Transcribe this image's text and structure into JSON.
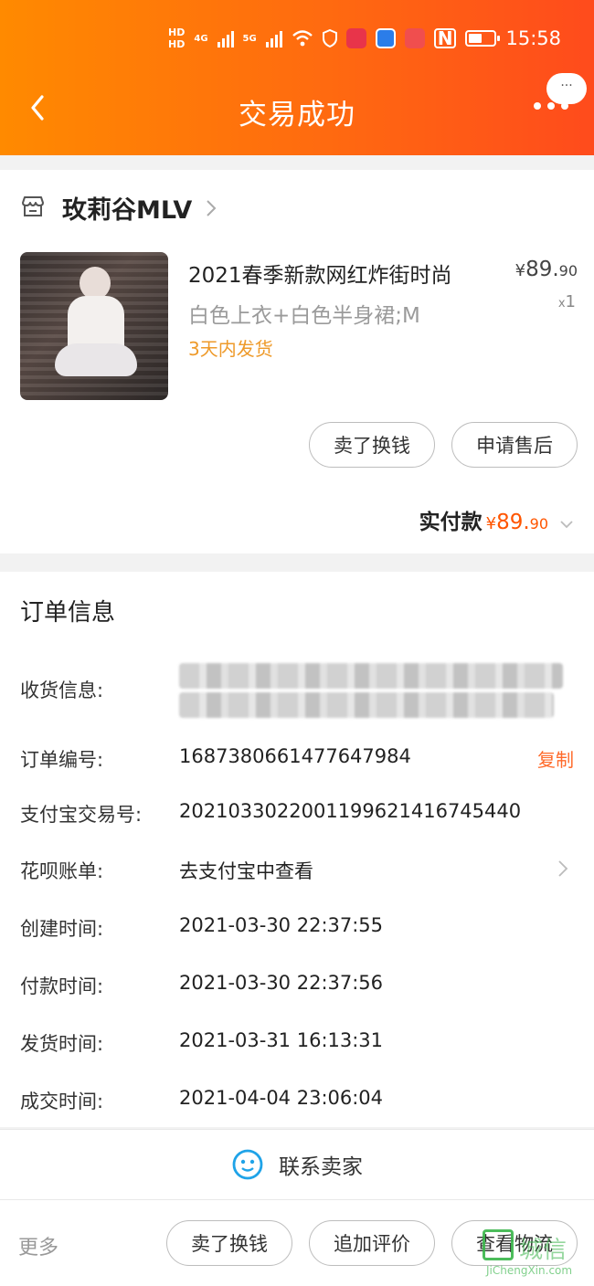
{
  "status_bar": {
    "time": "15:58",
    "hd1": "HD",
    "hd2": "HD",
    "net1": "4G",
    "net2": "5G",
    "icons": [
      "hd-icon",
      "signal-icon",
      "wifi-icon",
      "shield-icon",
      "app-icon-red",
      "app-icon-blue",
      "app-icon-play",
      "nfc-icon",
      "battery-icon"
    ]
  },
  "header": {
    "title": "交易成功",
    "bubble": "···"
  },
  "shop": {
    "name": "玫莉谷MLV"
  },
  "product": {
    "title": "2021春季新款网红炸街时尚",
    "spec": "白色上衣+白色半身裙;M",
    "ship_note": "3天内发货",
    "price_currency": "¥",
    "price_int": "89.",
    "price_dec": "90",
    "qty_prefix": "x",
    "qty": "1"
  },
  "actions": {
    "sell_label": "卖了换钱",
    "after_sale_label": "申请售后"
  },
  "paid": {
    "label": "实付款",
    "currency": "¥",
    "amount_int": "89.",
    "amount_dec": "90"
  },
  "order_info": {
    "title": "订单信息",
    "shipping_label": "收货信息:",
    "order_no_label": "订单编号:",
    "order_no": "1687380661477647984",
    "copy_label": "复制",
    "alipay_no_label": "支付宝交易号:",
    "alipay_no": "2021033022001199621416745440",
    "huabei_label": "花呗账单:",
    "huabei_value": "去支付宝中查看",
    "created_label": "创建时间:",
    "created": "2021-03-30 22:37:55",
    "paid_label": "付款时间:",
    "paid_time": "2021-03-30 22:37:56",
    "shipped_label": "发货时间:",
    "shipped": "2021-03-31 16:13:31",
    "closed_label": "成交时间:",
    "closed": "2021-04-04 23:06:04"
  },
  "contact": {
    "label": "联系卖家"
  },
  "bottom": {
    "more": "更多",
    "btn_sell": "卖了换钱",
    "btn_review": "追加评价",
    "btn_logistics": "查看物流"
  },
  "watermark": {
    "cn": "城信",
    "en": "JiChengXin.com"
  },
  "colors": {
    "header_start": "#ff8a00",
    "header_end": "#ff4b1c",
    "accent_price": "#ff5500",
    "ship_note": "#ee9a2a"
  }
}
